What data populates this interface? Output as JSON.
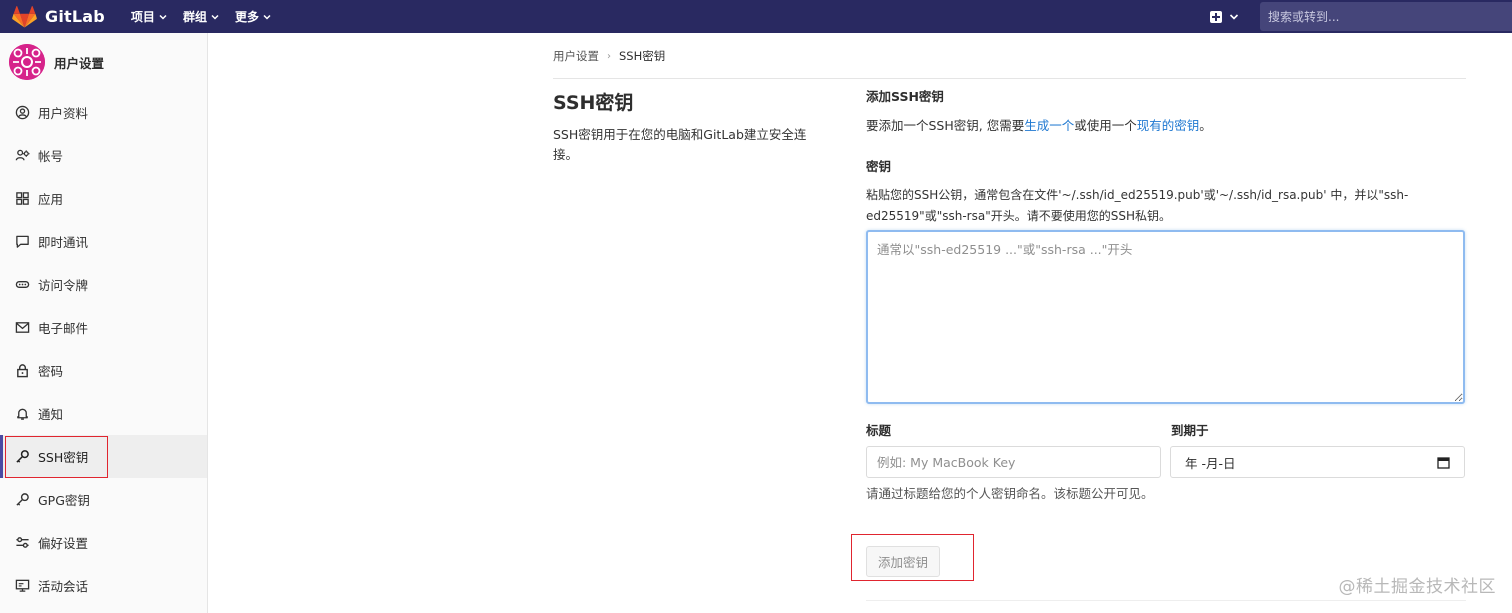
{
  "navbar": {
    "brand_name": "GitLab",
    "menu": [
      {
        "label": "项目"
      },
      {
        "label": "群组"
      },
      {
        "label": "更多"
      }
    ],
    "search_placeholder": "搜索或转到..."
  },
  "sidebar": {
    "title": "用户设置",
    "items": [
      {
        "label": "用户资料",
        "icon": "profile-icon"
      },
      {
        "label": "帐号",
        "icon": "account-icon"
      },
      {
        "label": "应用",
        "icon": "applications-icon"
      },
      {
        "label": "即时通讯",
        "icon": "chat-icon"
      },
      {
        "label": "访问令牌",
        "icon": "token-icon"
      },
      {
        "label": "电子邮件",
        "icon": "mail-icon"
      },
      {
        "label": "密码",
        "icon": "lock-icon"
      },
      {
        "label": "通知",
        "icon": "bell-icon"
      },
      {
        "label": "SSH密钥",
        "icon": "key-icon",
        "active": true
      },
      {
        "label": "GPG密钥",
        "icon": "key-icon"
      },
      {
        "label": "偏好设置",
        "icon": "preferences-icon"
      },
      {
        "label": "活动会话",
        "icon": "monitor-icon"
      }
    ]
  },
  "breadcrumb": {
    "parent": "用户设置",
    "current": "SSH密钥"
  },
  "page": {
    "title": "SSH密钥",
    "description": "SSH密钥用于在您的电脑和GitLab建立安全连接。"
  },
  "form": {
    "section_title": "添加SSH密钥",
    "intro_prefix": "要添加一个SSH密钥, 您需要",
    "intro_link1": "生成一个",
    "intro_middle": "或使用一个",
    "intro_link2": "现有的密钥",
    "intro_suffix": "。",
    "key_label": "密钥",
    "key_help": "粘贴您的SSH公钥，通常包含在文件'~/.ssh/id_ed25519.pub'或'~/.ssh/id_rsa.pub' 中，并以\"ssh-ed25519\"或\"ssh-rsa\"开头。请不要使用您的SSH私钥。",
    "key_placeholder": "通常以\"ssh-ed25519 ...\"或\"ssh-rsa ...\"开头",
    "title_label": "标题",
    "title_placeholder": "例如: My MacBook Key",
    "title_help": "请通过标题给您的个人密钥命名。该标题公开可见。",
    "expires_label": "到期于",
    "expires_value": "年 -月-日",
    "submit_label": "添加密钥"
  },
  "watermark": "@稀土掘金技术社区",
  "colors": {
    "navbar": "#292961",
    "link": "#1f78d1",
    "annotation": "#e0252f"
  }
}
